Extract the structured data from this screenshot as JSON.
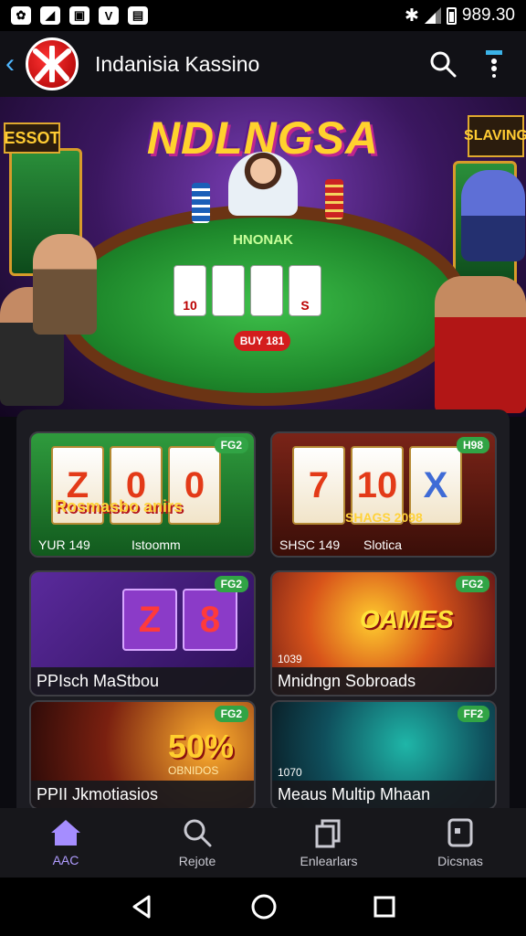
{
  "status_bar": {
    "time": "989.30",
    "left_icons": [
      "notification-icon",
      "app-icon",
      "message-icon",
      "vpn-icon",
      "mail-icon"
    ]
  },
  "app_bar": {
    "title": "Indanisia Kassino"
  },
  "hero": {
    "title": "NDLNGSA",
    "sign_left": "ESSOT",
    "sign_right": "SLAVING",
    "table_label": "HNONAK",
    "cards": [
      "10",
      "",
      "",
      "S"
    ],
    "bet_label": "BUY 181"
  },
  "games": [
    {
      "badge": "FG2",
      "title": "Rosmasbo anirs",
      "caption_left": "YUR 149",
      "caption_right": "Istoomm",
      "reels": [
        "Z",
        "0",
        "0"
      ]
    },
    {
      "badge": "H98",
      "title": "SHAGS 2098",
      "caption_left": "SHSC 149",
      "caption_right": "Slotica",
      "reels": [
        "7",
        "10",
        "X"
      ]
    },
    {
      "badge": "FG2",
      "title": "PPIsch MaStbou",
      "reels": [
        "Z",
        "8"
      ]
    },
    {
      "badge": "FG2",
      "title": "Mnidngn Sobroads",
      "sub": "1039",
      "art_text": "OAMES"
    },
    {
      "badge": "FG2",
      "title": "PPII Jkmotiasios",
      "art_text": "50%",
      "art_sub": "OBNIDOS"
    },
    {
      "badge": "FF2",
      "title": "Meaus Multip Mhaan",
      "sub": "1070"
    }
  ],
  "bottom_nav": [
    {
      "label": "AAC",
      "icon": "home-icon",
      "active": true
    },
    {
      "label": "Rejote",
      "icon": "search-icon",
      "active": false
    },
    {
      "label": "Enlearlars",
      "icon": "copy-icon",
      "active": false
    },
    {
      "label": "Dicsnas",
      "icon": "tablet-icon",
      "active": false
    }
  ],
  "colors": {
    "accent": "#b09cff",
    "badge": "#31a445",
    "logo_red": "#e02020",
    "back_blue": "#4fb7ff"
  }
}
